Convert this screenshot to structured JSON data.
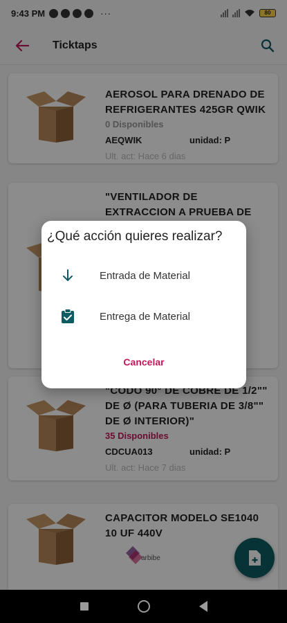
{
  "status_bar": {
    "time": "9:43 PM",
    "more": "···",
    "battery": "80"
  },
  "app_bar": {
    "title": "Ticktaps"
  },
  "products": [
    {
      "name": "AEROSOL PARA DRENADO DE REFRIGERANTES 425GR QWIK",
      "available": "0 Disponibles",
      "code": "AEQWIK",
      "unit": "unidad: P",
      "updated": "Ult. act: Hace 6 dias"
    },
    {
      "name": "\"VENTILADOR DE EXTRACCION A PRUEBA DE",
      "available": "",
      "code": "",
      "unit": "",
      "updated": ""
    },
    {
      "name": "\"CODO 90° DE COBRE DE 1/2\"\" DE Ø (PARA TUBERIA DE 3/8\"\" DE Ø INTERIOR)\"",
      "available": "35 Disponibles",
      "code": "CDCUA013",
      "unit": "unidad: P",
      "updated": "Ult. act: Hace 7 dias"
    },
    {
      "name": "CAPACITOR MODELO SE1040 10 UF 440V",
      "available": "",
      "code": "",
      "unit": "",
      "updated": ""
    }
  ],
  "dialog": {
    "title": "¿Qué acción quieres realizar?",
    "options": [
      {
        "label": "Entrada de Material",
        "icon": "arrow-down-icon"
      },
      {
        "label": "Entrega de Material",
        "icon": "clipboard-check-icon"
      }
    ],
    "cancel": "Cancelar"
  },
  "colors": {
    "accent": "#c2185b",
    "primary": "#0d5c63"
  }
}
